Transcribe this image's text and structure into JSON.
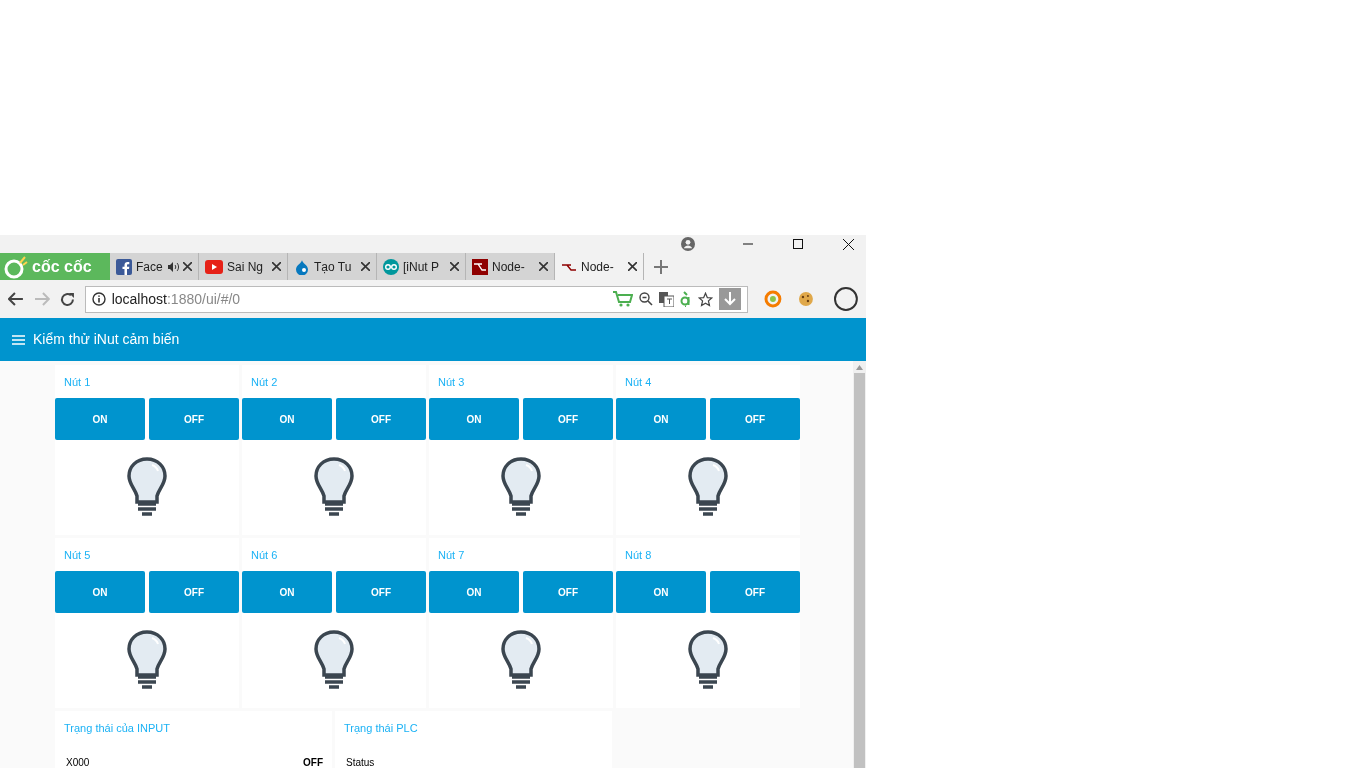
{
  "browser": {
    "logo": "cốc cốc",
    "tabs": [
      {
        "label": "Face",
        "audio": true,
        "kind": "facebook",
        "selected": false
      },
      {
        "label": "Sai Ng",
        "audio": false,
        "kind": "youtube",
        "selected": false
      },
      {
        "label": "Tạo Tu",
        "audio": false,
        "kind": "drop",
        "selected": false
      },
      {
        "label": "[iNut P",
        "audio": false,
        "kind": "eyes",
        "selected": false
      },
      {
        "label": "Node-",
        "audio": false,
        "kind": "nodered",
        "selected": false
      },
      {
        "label": "Node-",
        "audio": false,
        "kind": "nodered-line",
        "selected": true
      }
    ],
    "url_host": "localhost",
    "url_path": ":1880/ui/#/0"
  },
  "app": {
    "title": "Kiểm thử iNut cảm biến",
    "switches": [
      {
        "title": "Nút 1",
        "on": "ON",
        "off": "OFF",
        "lit": false
      },
      {
        "title": "Nút 2",
        "on": "ON",
        "off": "OFF",
        "lit": false
      },
      {
        "title": "Nút 3",
        "on": "ON",
        "off": "OFF",
        "lit": false
      },
      {
        "title": "Nút 4",
        "on": "ON",
        "off": "OFF",
        "lit": false
      },
      {
        "title": "Nút 5",
        "on": "ON",
        "off": "OFF",
        "lit": false
      },
      {
        "title": "Nút 6",
        "on": "ON",
        "off": "OFF",
        "lit": false
      },
      {
        "title": "Nút 7",
        "on": "ON",
        "off": "OFF",
        "lit": false
      },
      {
        "title": "Nút 8",
        "on": "ON",
        "off": "OFF",
        "lit": false
      }
    ],
    "panels": [
      {
        "title": "Trạng thái của INPUT",
        "rows": [
          {
            "label": "X000",
            "value": "OFF"
          }
        ]
      },
      {
        "title": "Trạng thái PLC",
        "rows": [
          {
            "label": "Status"
          }
        ]
      }
    ]
  }
}
